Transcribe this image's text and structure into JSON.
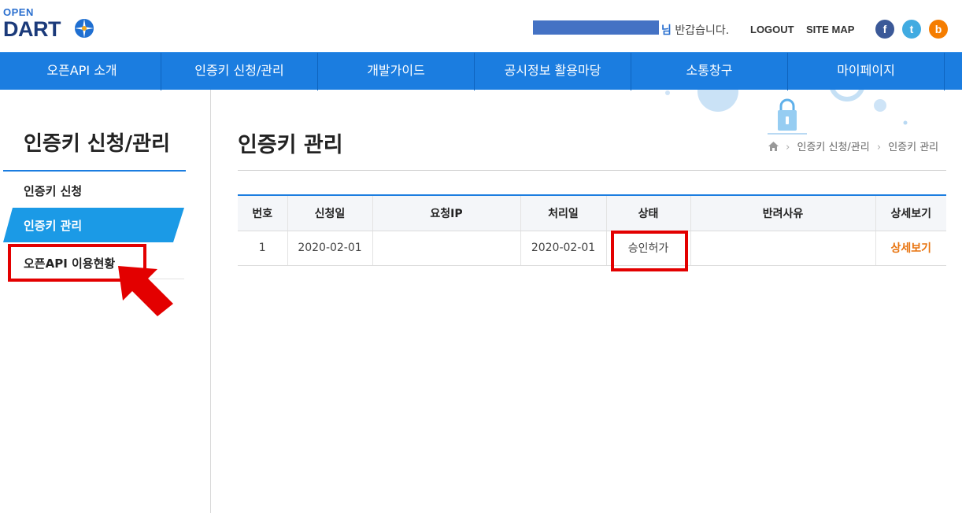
{
  "header": {
    "logo_top": "OPEN",
    "logo_main": "DART",
    "greeting_suffix": "님",
    "greeting_text": "반갑습니다.",
    "logout": "LOGOUT",
    "sitemap": "SITE MAP",
    "social": [
      {
        "name": "facebook",
        "glyph": "f",
        "color": "#3b5998"
      },
      {
        "name": "twitter",
        "glyph": "t",
        "color": "#41abe1"
      },
      {
        "name": "blogger",
        "glyph": "b",
        "color": "#f57d00"
      }
    ]
  },
  "nav": {
    "items": [
      "오픈API 소개",
      "인증키 신청/관리",
      "개발가이드",
      "공시정보 활용마당",
      "소통창구",
      "마이페이지"
    ]
  },
  "sidebar": {
    "title": "인증키 신청/관리",
    "items": [
      "인증키 신청",
      "인증키 관리",
      "오픈API 이용현황"
    ]
  },
  "main": {
    "title": "인증키 관리",
    "breadcrumb": [
      "인증키 신청/관리",
      "인증키 관리"
    ]
  },
  "table": {
    "headers": [
      "번호",
      "신청일",
      "요청IP",
      "처리일",
      "상태",
      "반려사유",
      "상세보기"
    ],
    "rows": [
      {
        "no": "1",
        "apply_date": "2020-02-01",
        "ip": "",
        "proc_date": "2020-02-01",
        "status": "승인허가",
        "reason": "",
        "detail": "상세보기"
      }
    ]
  },
  "colors": {
    "primary": "#1b7de0",
    "highlight": "#e30000",
    "detail_link": "#e8730e"
  }
}
